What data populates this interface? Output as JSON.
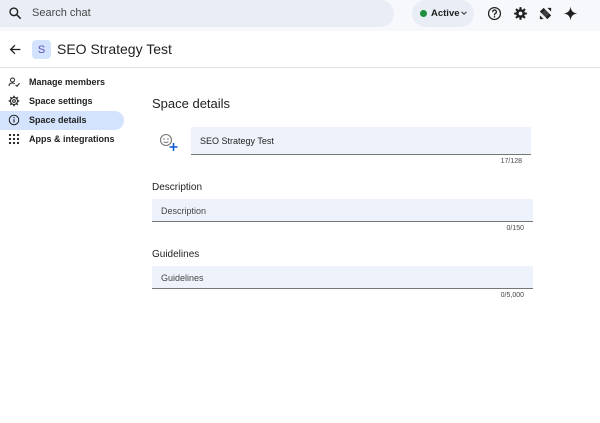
{
  "topbar": {
    "search_placeholder": "Search chat",
    "status_label": "Active",
    "status_color": "#1e8e3e",
    "icons": [
      "help-icon",
      "settings-icon",
      "apps-launcher-icon",
      "gemini-sparkle-icon"
    ]
  },
  "header": {
    "avatar_letter": "S",
    "space_name": "SEO Strategy Test"
  },
  "sidebar": {
    "items": [
      {
        "label": "Manage members",
        "icon": "manage-members-icon",
        "active": false
      },
      {
        "label": "Space settings",
        "icon": "gear-icon",
        "active": false
      },
      {
        "label": "Space details",
        "icon": "info-icon",
        "active": true
      },
      {
        "label": "Apps & integrations",
        "icon": "grid-apps-icon",
        "active": false
      }
    ]
  },
  "main": {
    "title": "Space details",
    "name_value": "SEO Strategy Test",
    "name_counter": "17/128",
    "description": {
      "label": "Description",
      "placeholder": "Description",
      "counter": "0/150"
    },
    "guidelines": {
      "label": "Guidelines",
      "placeholder": "Guidelines",
      "counter": "0/5,000"
    }
  },
  "colors": {
    "accent": "#d3e3fd",
    "field_bg": "#eef2fa",
    "topbar_bg": "#f6f8fc"
  }
}
